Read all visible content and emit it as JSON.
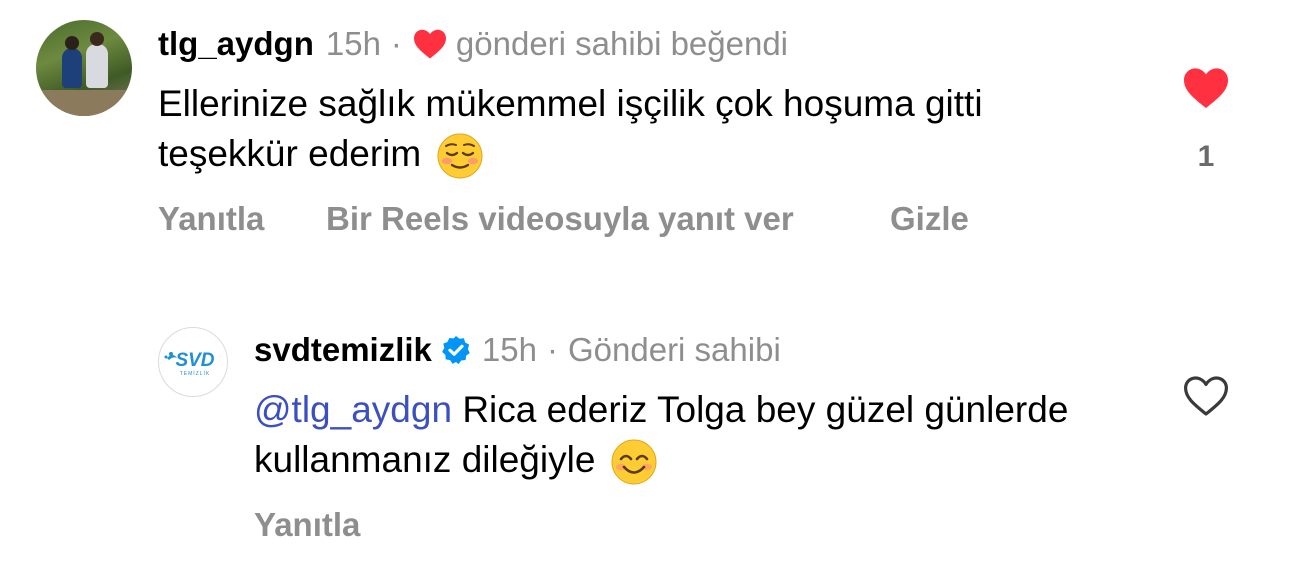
{
  "comment": {
    "username": "tlg_aydgn",
    "time": "15h",
    "separator": "·",
    "liked_by_author": "gönderi sahibi beğendi",
    "text": "Ellerinize sağlık mükemmel işçilik çok hoşuma gitti teşekkür ederim",
    "emoji": "relieved-smiling-face",
    "like_count": "1",
    "liked": true,
    "actions": {
      "reply": "Yanıtla",
      "reels_reply": "Bir Reels videosuyla yanıt ver",
      "hide": "Gizle"
    }
  },
  "reply": {
    "username": "svdtemizlik",
    "verified": true,
    "time": "15h",
    "separator": "·",
    "role": "Gönderi sahibi",
    "mention": "@tlg_aydgn",
    "text": "Rica ederiz Tolga bey güzel günlerde kullanmanız dileğiyle",
    "emoji": "smiling-face-with-smiling-eyes",
    "liked": false,
    "actions": {
      "reply": "Yanıtla"
    },
    "avatar_logo": {
      "text": "SVD",
      "subtext": "TEMİZLİK"
    }
  },
  "colors": {
    "heart_red": "#ff3040",
    "verified_blue": "#0095f6",
    "mention_blue": "#3c4fbf",
    "muted_gray": "#8e8e8e",
    "logo_blue": "#1f8fd6"
  }
}
